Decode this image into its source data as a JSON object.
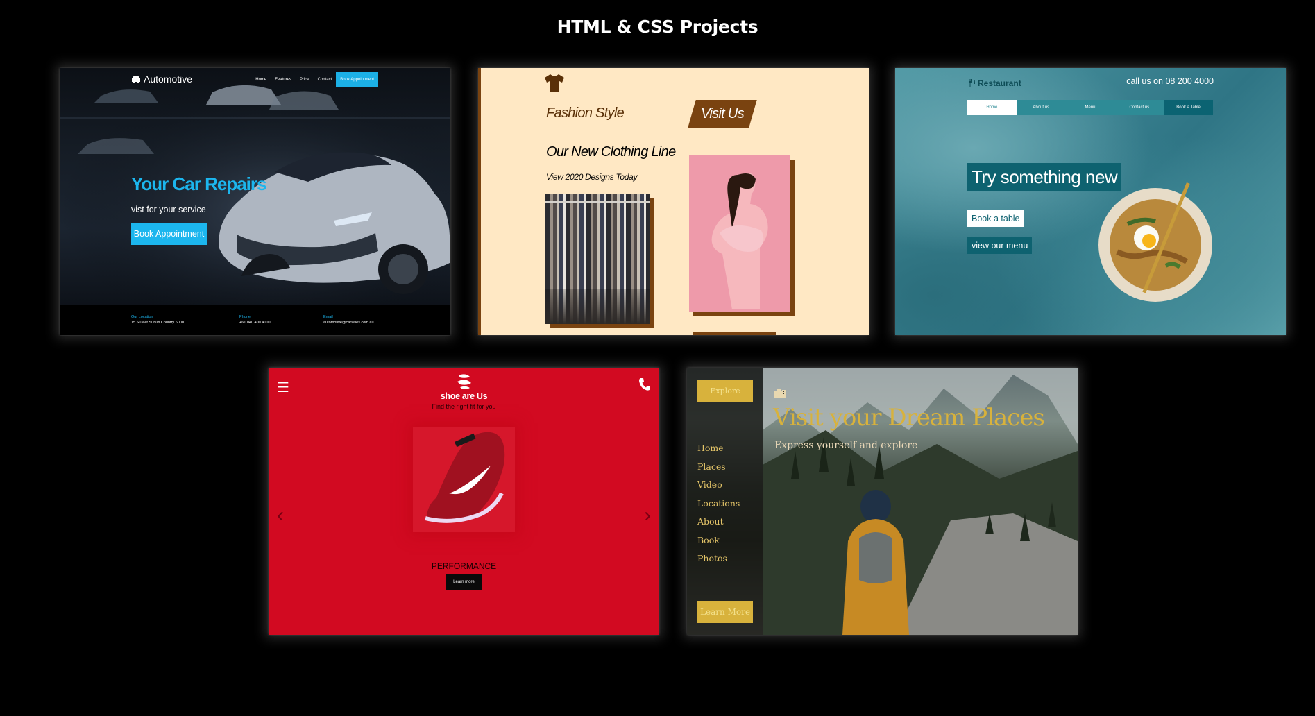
{
  "page": {
    "title": "HTML & CSS Projects"
  },
  "projects": [
    {
      "id": "automotive",
      "logo": "Automotive",
      "nav": [
        "Home",
        "Features",
        "Price",
        "Contact"
      ],
      "nav_button": "Book Appointment",
      "headline": "Your Car Repairs",
      "subheadline": "vist for your service",
      "cta": "Book Appointment",
      "footer": [
        {
          "heading": "Our Location",
          "value": "15 STreet Suburl Country 6000"
        },
        {
          "heading": "Phone",
          "value": "+61 040 400 4000"
        },
        {
          "heading": "Email",
          "value": "automotive@carsales.com.au"
        }
      ],
      "accent": "#1cb6ee"
    },
    {
      "id": "fashion",
      "brand": "Fashion Style",
      "visit_button": "Visit Us",
      "heading": "Our New Clothing Line",
      "subheading": "View 2020 Designs Today",
      "accent": "#7a4310",
      "background": "#ffe8c4"
    },
    {
      "id": "restaurant",
      "logo": "Restaurant",
      "call": "call us on 08 200 4000",
      "nav": [
        "Home",
        "About us",
        "Menu",
        "Contact us",
        "Book a Table"
      ],
      "headline": "Try something new",
      "button_primary": "Book a table",
      "button_secondary": "view our menu",
      "accent": "#0e6270"
    },
    {
      "id": "shoes",
      "brand": "shoe are Us",
      "tagline": "Find the right fit for you",
      "product_label": "PERFORMANCE",
      "learn_button": "Learn more",
      "background": "#d20a21"
    },
    {
      "id": "travel",
      "explore_button": "Explore",
      "menu": [
        "Home",
        "Places",
        "Video",
        "Locations",
        "About",
        "Book",
        "Photos"
      ],
      "learn_button": "Learn More",
      "headline": "Visit your Dream Places",
      "subheadline": "Express yourself and explore",
      "accent": "#d8b23c"
    }
  ]
}
